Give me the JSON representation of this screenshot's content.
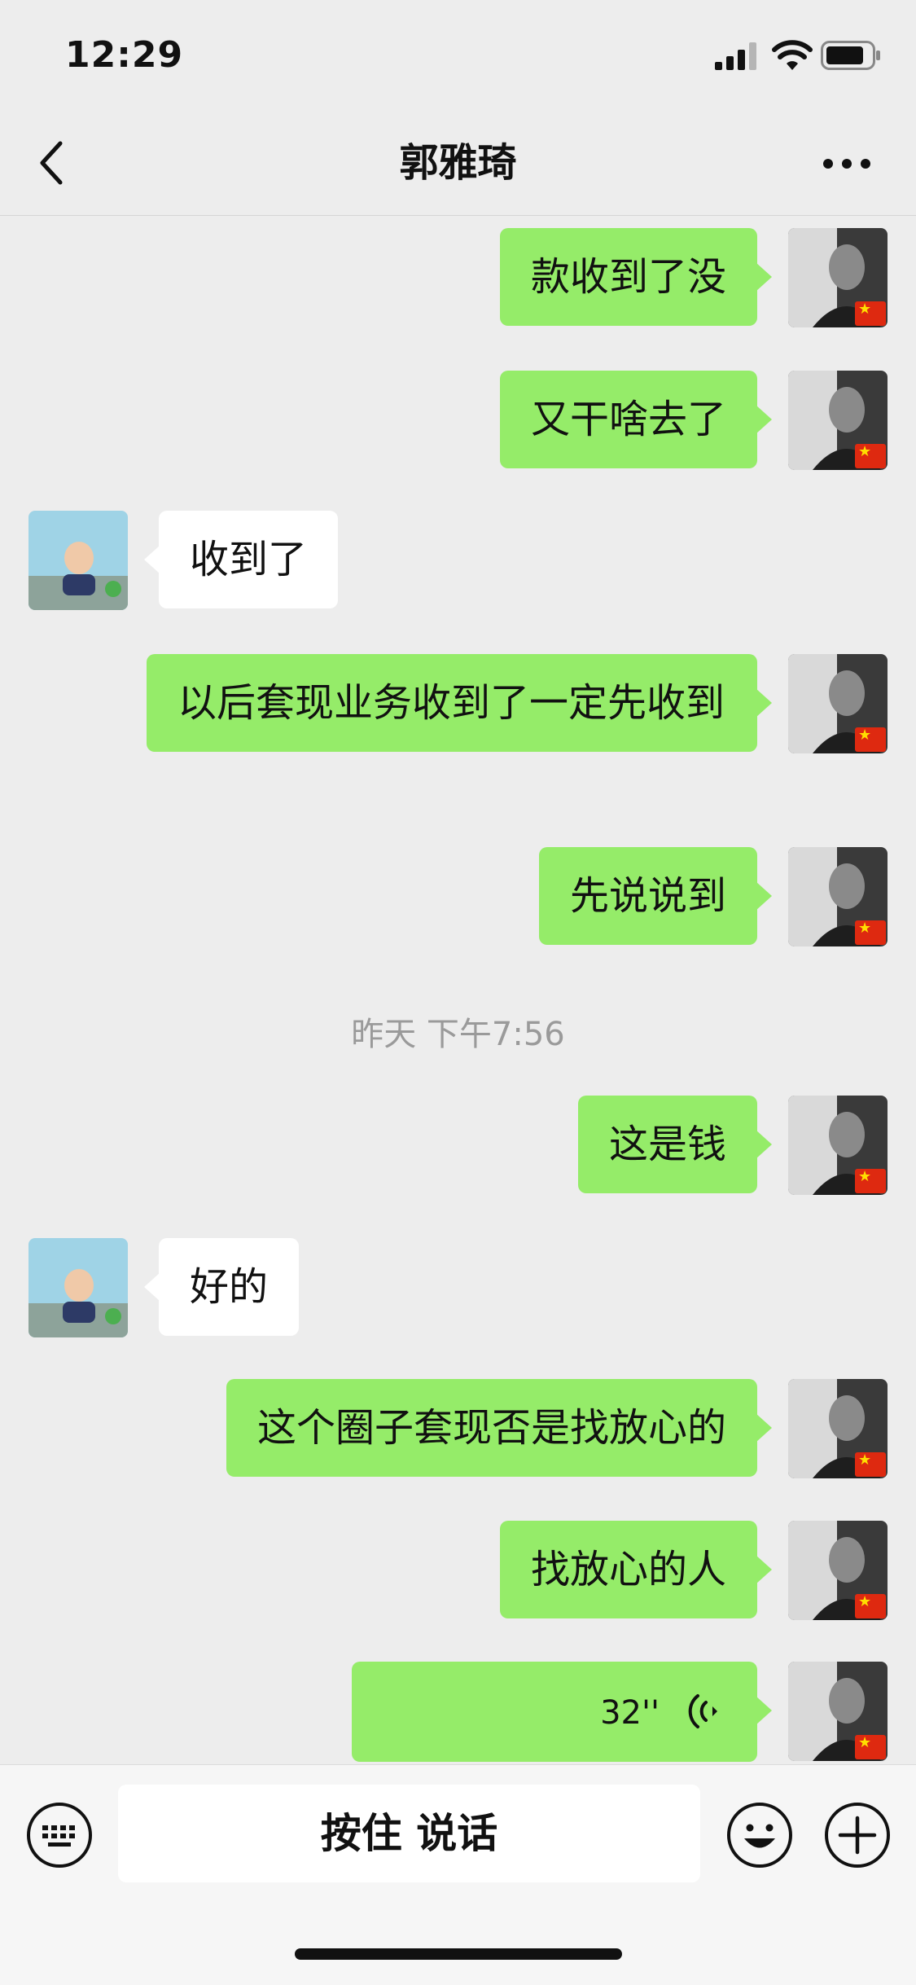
{
  "status_bar": {
    "time": "12:29"
  },
  "nav": {
    "title": "郭雅琦"
  },
  "messages": [
    {
      "side": "me",
      "text": "款收到了没"
    },
    {
      "side": "me",
      "text": "又干啥去了"
    },
    {
      "side": "other",
      "text": "收到了"
    },
    {
      "side": "me",
      "text": "以后套现业务收到了一定先收到"
    },
    {
      "side": "me",
      "text": "先说说到"
    },
    {
      "type": "timestamp",
      "text": "昨天 下午7:56"
    },
    {
      "side": "me",
      "text": "这是钱"
    },
    {
      "side": "other",
      "text": "好的"
    },
    {
      "side": "me",
      "text": "这个圈子套现否是找放心的"
    },
    {
      "side": "me",
      "text": "找放心的人"
    },
    {
      "side": "me",
      "type": "voice",
      "duration": "32''"
    }
  ],
  "input": {
    "talk_label": "按住 说话"
  },
  "colors": {
    "bubble_me": "#95ec69",
    "bubble_other": "#ffffff",
    "background": "#ededed"
  },
  "icons": [
    "back-chevron-icon",
    "more-dots-icon",
    "keyboard-icon",
    "emoji-icon",
    "plus-icon",
    "voice-wave-icon",
    "signal-icon",
    "wifi-icon",
    "battery-icon"
  ]
}
